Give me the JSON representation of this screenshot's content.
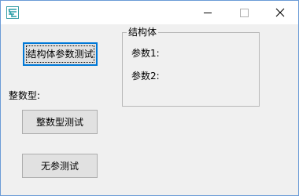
{
  "window": {
    "title_icon": "app-logo-icon",
    "controls": {
      "minimize": "minimize-icon",
      "maximize": "maximize-icon",
      "close": "close-icon"
    }
  },
  "buttons": {
    "struct_test": "结构体参数测试",
    "int_test": "整数型测试",
    "noparam_test": "无参测试"
  },
  "labels": {
    "int_type": "整数型:"
  },
  "groupbox": {
    "title": "结构体",
    "param1": "参数1:",
    "param2": "参数2:"
  },
  "colors": {
    "window_border": "#6b9bd6",
    "client_bg": "#f0f0f0",
    "button_bg": "#e1e1e1",
    "focus_border": "#0078d7"
  }
}
